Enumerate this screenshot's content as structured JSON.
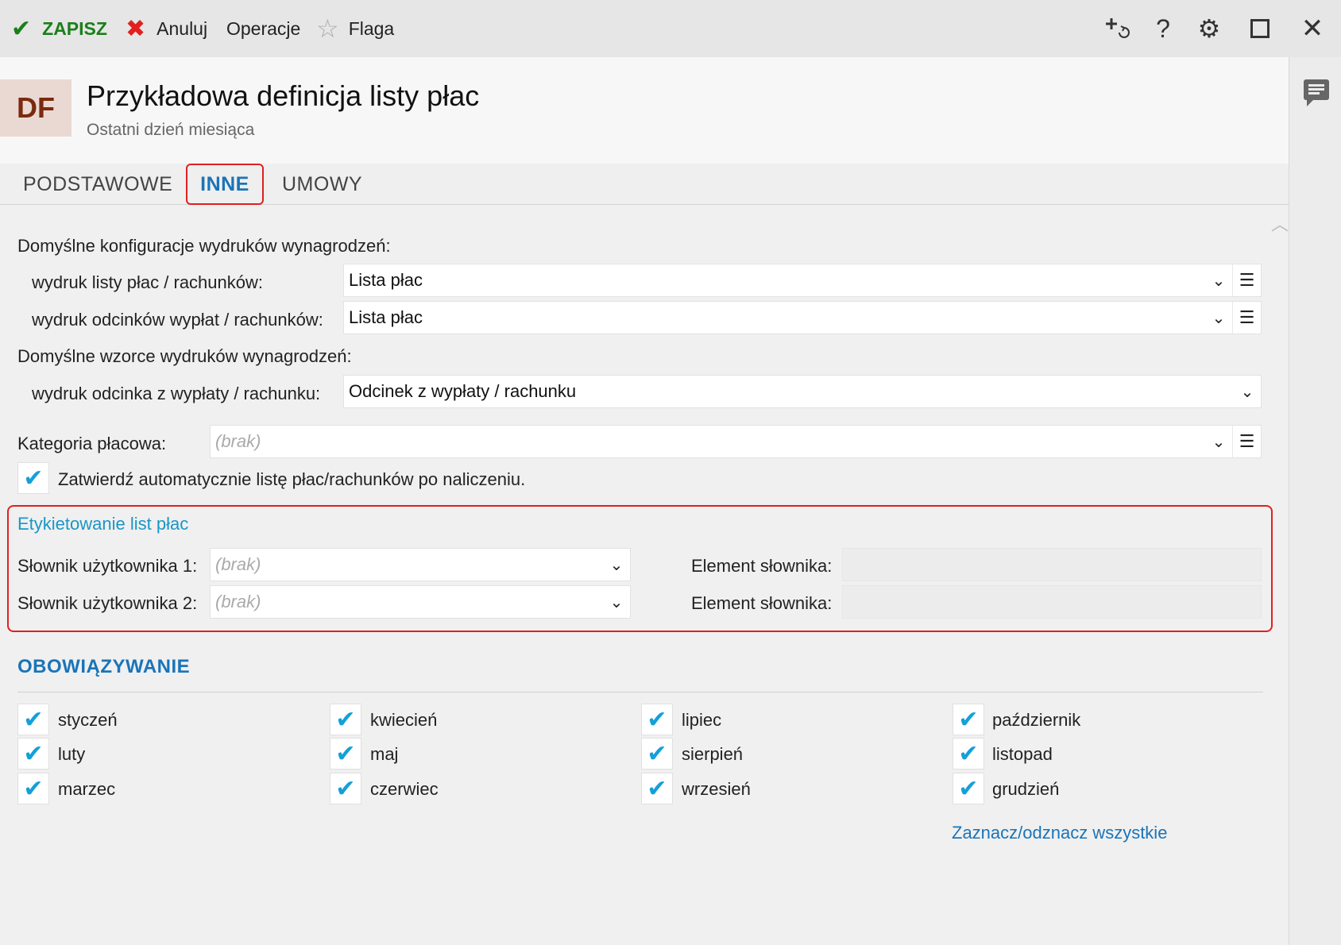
{
  "toolbar": {
    "save": "ZAPISZ",
    "cancel": "Anuluj",
    "operations": "Operacje",
    "flag": "Flaga"
  },
  "header": {
    "avatar": "DF",
    "title": "Przykładowa definicja listy płac",
    "subtitle": "Ostatni dzień miesiąca"
  },
  "tabs": [
    "PODSTAWOWE",
    "INNE",
    "UMOWY"
  ],
  "print_config": {
    "heading": "Domyślne konfiguracje wydruków wynagrodzeń:",
    "payroll_label": "wydruk listy płac / rachunków:",
    "payroll_value": "Lista płac",
    "stubs_label": "wydruk odcinków wypłat / rachunków:",
    "stubs_value": "Lista płac"
  },
  "print_templates": {
    "heading": "Domyślne wzorce wydruków wynagrodzeń:",
    "stub_label": "wydruk odcinka z wypłaty / rachunku:",
    "stub_value": "Odcinek z wypłaty / rachunku"
  },
  "category": {
    "label": "Kategoria płacowa:",
    "placeholder": "(brak)"
  },
  "auto_approve": {
    "label": "Zatwierdź automatycznie listę płac/rachunków po naliczeniu.",
    "checked": true
  },
  "labeling": {
    "title": "Etykietowanie list płac",
    "dict1_label": "Słownik użytkownika 1:",
    "dict1_value": "(brak)",
    "dict2_label": "Słownik użytkownika 2:",
    "dict2_value": "(brak)",
    "element1_label": "Element słownika:",
    "element2_label": "Element słownika:"
  },
  "validity": {
    "title": "OBOWIĄZYWANIE",
    "months": [
      "styczeń",
      "luty",
      "marzec",
      "kwiecień",
      "maj",
      "czerwiec",
      "lipiec",
      "sierpień",
      "wrzesień",
      "październik",
      "listopad",
      "grudzień"
    ],
    "toggle_all": "Zaznacz/odznacz wszystkie"
  },
  "colors": {
    "accent": "#1a74b8",
    "check": "#14a0d8",
    "highlight": "#e02020",
    "save": "#1a7f1a"
  },
  "icons": [
    "checkmark-icon",
    "close-x-icon",
    "star-icon",
    "add-refresh-icon",
    "help-icon",
    "gear-icon",
    "maximize-icon",
    "close-icon",
    "comment-icon",
    "chevron-down-icon",
    "list-menu-icon",
    "chevron-up-icon"
  ]
}
